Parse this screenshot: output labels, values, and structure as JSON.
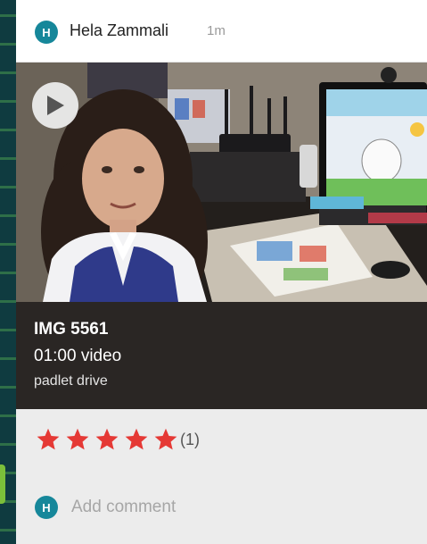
{
  "post": {
    "author_initial": "H",
    "author": "Hela Zammali",
    "time": "1m"
  },
  "media": {
    "play_icon": "play-icon",
    "title": "IMG 5561",
    "subtitle": "01:00 video",
    "source": "padlet drive"
  },
  "rating": {
    "stars_filled": 5,
    "stars_total": 5,
    "count": "(1)",
    "star_color": "#e53935"
  },
  "comment": {
    "avatar_initial": "H",
    "placeholder": "Add comment"
  },
  "colors": {
    "avatar_bg": "#16879a",
    "caption_bg": "#2a2624",
    "card_bg": "#ececec"
  }
}
